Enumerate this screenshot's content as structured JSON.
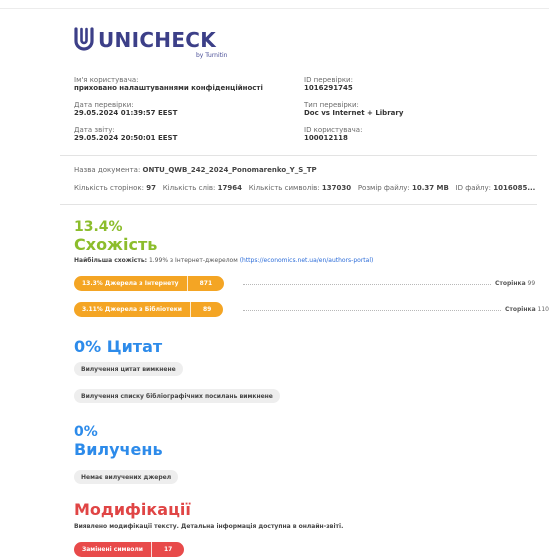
{
  "colors": {
    "brand": "#3c3f88",
    "similarity": "#8cbd2c",
    "citations": "#2d8bea",
    "modifications": "#e04545",
    "internet_sources": "#f4a524",
    "replaced_chars": "#e84a4a"
  },
  "logo": {
    "icon": "unicheck-u-logo-icon",
    "name": "UNICHECK",
    "sub": "by Turnitin"
  },
  "meta": {
    "user_label": "Ім'я користувача:",
    "user_value": "приховано налаштуваннями конфіденційності",
    "check_date_label": "Дата перевірки:",
    "check_date_value": "29.05.2024 01:39:57 EEST",
    "report_date_label": "Дата звіту:",
    "report_date_value": "29.05.2024 20:50:01 EEST",
    "check_id_label": "ID перевірки:",
    "check_id_value": "1016291745",
    "check_type_label": "Тип перевірки:",
    "check_type_value": "Doc vs Internet + Library",
    "user_id_label": "ID користувача:",
    "user_id_value": "100012118"
  },
  "document": {
    "name_label": "Назва документа:",
    "name_value": "ONTU_QWB_242_2024_Ponomarenko_Y_S_TP",
    "pages_label": "Кількість сторінок:",
    "pages_value": "97",
    "words_label": "Кількість слів:",
    "words_value": "17964",
    "chars_label": "Кількість символів:",
    "chars_value": "137030",
    "size_label": "Розмір файлу:",
    "size_value": "10.37 MB",
    "file_id_label": "ID файлу:",
    "file_id_value": "1016085..."
  },
  "similarity": {
    "percent": "13.4%",
    "title": "Схожість",
    "note_prefix": "Найбільша схожість:",
    "note_value": "1.99% з Інтернет-джерелом",
    "note_link": "(https://economics.net.ua/en/authors-portal)",
    "sources": [
      {
        "label": "13.3% Джерела з Інтернету",
        "count": "871",
        "page_label": "Сторінка",
        "page_value": "99"
      },
      {
        "label": "3.11% Джерела з Бібліотеки",
        "count": "89",
        "page_label": "Сторінка",
        "page_value": "110"
      }
    ]
  },
  "citations": {
    "title": "0% Цитат",
    "chips": [
      "Вилучення цитат вимкнене",
      "Вилучення списку бібліографічних посилань вимкнене"
    ]
  },
  "exclusions": {
    "percent": "0%",
    "title": "Вилучень",
    "chip": "Немає вилучених джерел"
  },
  "modifications": {
    "title": "Модифікації",
    "note": "Виявлено модифікації тексту. Детальна інформація доступна в онлайн-звіті.",
    "pill_label": "Замінені символи",
    "pill_count": "17"
  }
}
